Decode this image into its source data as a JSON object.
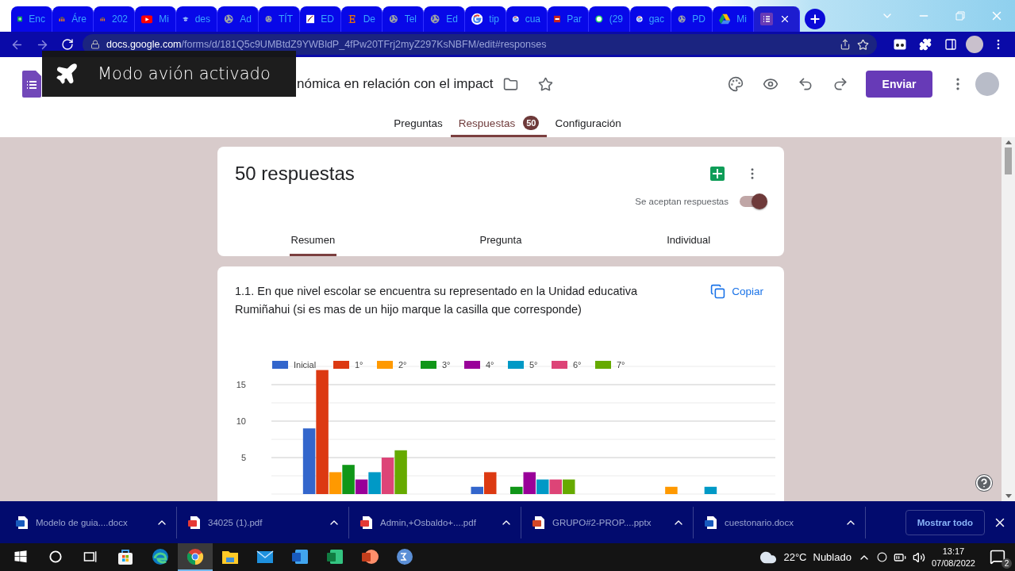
{
  "browser": {
    "tabs": [
      {
        "kind": "sheets",
        "label": "Enc",
        "selected": false
      },
      {
        "kind": "moodle",
        "label": "Áre",
        "selected": false
      },
      {
        "kind": "moodle",
        "label": "202",
        "selected": false
      },
      {
        "kind": "youtube",
        "label": "Mi",
        "selected": false
      },
      {
        "kind": "cap",
        "label": "des",
        "selected": false
      },
      {
        "kind": "globe",
        "label": "Ad",
        "selected": false
      },
      {
        "kind": "globe",
        "label": "TÍT",
        "selected": false
      },
      {
        "kind": "image",
        "label": "ED",
        "selected": false
      },
      {
        "kind": "letter",
        "label": "De",
        "selected": false
      },
      {
        "kind": "globe",
        "label": "Tel",
        "selected": false
      },
      {
        "kind": "globe",
        "label": "Ed",
        "selected": false
      },
      {
        "kind": "google",
        "label": "tip",
        "selected": false
      },
      {
        "kind": "google",
        "label": "cua",
        "selected": false
      },
      {
        "kind": "news",
        "label": "Par",
        "selected": false
      },
      {
        "kind": "chat",
        "label": "(29",
        "selected": false
      },
      {
        "kind": "google",
        "label": "gac",
        "selected": false
      },
      {
        "kind": "globe",
        "label": "PD",
        "selected": false
      },
      {
        "kind": "drive",
        "label": "Mi",
        "selected": false
      },
      {
        "kind": "forms",
        "selected": true
      }
    ],
    "url_host": "docs.google.com",
    "url_path": "/forms/d/181Q5c9UMBtdZ9YWBldP_4fPw20TFrj2myZ297KsNBFM/edit#responses"
  },
  "toast": {
    "text": "Modo avión activado"
  },
  "form": {
    "title": "nómica en relación con el impact",
    "send_button": "Enviar",
    "tabs": [
      {
        "label": "Preguntas",
        "selected": false
      },
      {
        "label": "Respuestas",
        "selected": true,
        "badge": "50"
      },
      {
        "label": "Configuración",
        "selected": false
      }
    ]
  },
  "summary": {
    "count": "50 respuestas",
    "accepting_label": "Se aceptan respuestas",
    "accepting": true,
    "view_tabs": [
      {
        "label": "Resumen",
        "selected": true
      },
      {
        "label": "Pregunta",
        "selected": false
      },
      {
        "label": "Individual",
        "selected": false
      }
    ]
  },
  "question": {
    "text": "1.1. En que nivel escolar se encuentra su representado en la Unidad educativa Rumiñahui (si es mas de un hijo marque la casilla que corresponde)",
    "copy_label": "Copiar",
    "chart_data": {
      "type": "bar",
      "grid": true,
      "legend": true,
      "ylim": [
        0,
        17.5
      ],
      "yticks": [
        5,
        10,
        15
      ],
      "series": [
        {
          "name": "Inicial",
          "color": "#3366cc",
          "values": [
            9,
            1,
            0
          ]
        },
        {
          "name": "1°",
          "color": "#dc3912",
          "values": [
            17,
            3,
            0
          ]
        },
        {
          "name": "2°",
          "color": "#ff9900",
          "values": [
            3,
            0,
            1
          ]
        },
        {
          "name": "3°",
          "color": "#109618",
          "values": [
            4,
            1,
            0
          ]
        },
        {
          "name": "4°",
          "color": "#990099",
          "values": [
            2,
            3,
            0
          ]
        },
        {
          "name": "5°",
          "color": "#0099c6",
          "values": [
            3,
            2,
            1
          ]
        },
        {
          "name": "6°",
          "color": "#dd4477",
          "values": [
            5,
            2,
            0
          ]
        },
        {
          "name": "7°",
          "color": "#66aa00",
          "values": [
            6,
            2,
            0
          ]
        }
      ]
    }
  },
  "downloads": {
    "items": [
      {
        "kind": "docx",
        "name": "Modelo de guia....docx"
      },
      {
        "kind": "pdf",
        "name": "34025 (1).pdf"
      },
      {
        "kind": "pdf",
        "name": "Admin,+Osbaldo+....pdf"
      },
      {
        "kind": "pptx",
        "name": "GRUPO#2-PROP....pptx"
      },
      {
        "kind": "docx",
        "name": "cuestonario.docx"
      }
    ],
    "show_all": "Mostrar todo"
  },
  "taskbar": {
    "apps": [
      {
        "kind": "start",
        "selected": false
      },
      {
        "kind": "search",
        "selected": false
      },
      {
        "kind": "taskview",
        "selected": false
      },
      {
        "kind": "store",
        "selected": false
      },
      {
        "kind": "edge",
        "selected": false
      },
      {
        "kind": "chrome",
        "selected": true
      },
      {
        "kind": "explorer",
        "selected": false
      },
      {
        "kind": "mail",
        "selected": false
      },
      {
        "kind": "word",
        "selected": false
      },
      {
        "kind": "excel",
        "selected": false
      },
      {
        "kind": "powerpoint",
        "selected": false
      },
      {
        "kind": "math",
        "selected": false
      }
    ],
    "temperature": "22°C",
    "weather": "Nublado",
    "time": "13:17",
    "date": "07/08/2022",
    "notifications": "2"
  }
}
